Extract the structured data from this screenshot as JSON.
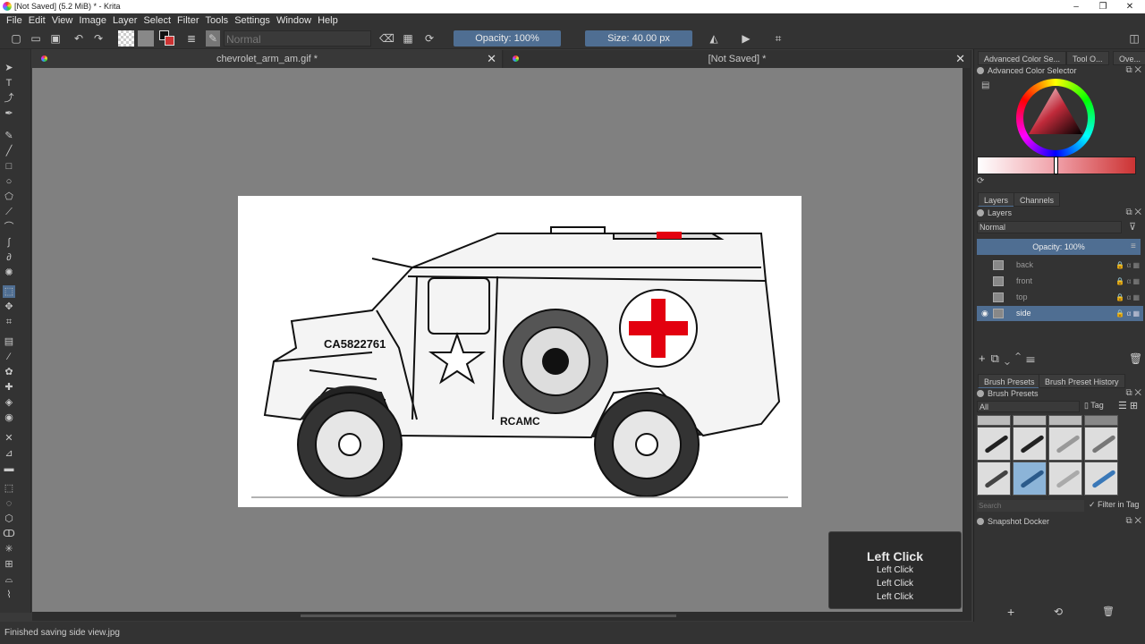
{
  "window": {
    "title": "[Not Saved]  (5.2 MiB)  * - Krita",
    "minimize": "–",
    "maximize": "❐",
    "close": "✕"
  },
  "menu": [
    "File",
    "Edit",
    "View",
    "Image",
    "Layer",
    "Select",
    "Filter",
    "Tools",
    "Settings",
    "Window",
    "Help"
  ],
  "toolbar": {
    "blend_mode": "Normal",
    "opacity": "Opacity: 100%",
    "size": "Size: 40.00 px"
  },
  "tabs": [
    {
      "label": "chevrolet_arm_am.gif *",
      "close": "✕"
    },
    {
      "label": "[Not Saved]  *",
      "close": "✕"
    }
  ],
  "canvas": {
    "license_plate": "CA5822761",
    "unit_label": "RCAMC"
  },
  "overlay": {
    "title": "Left Click",
    "lines": [
      "Left Click",
      "Left Click",
      "Left Click"
    ]
  },
  "status": "Finished saving side view.jpg",
  "right_panel": {
    "top_tabs": [
      "Advanced Color Se...",
      "Tool O...",
      "Ove..."
    ],
    "color_selector_title": "Advanced Color Selector",
    "layers_tabs": [
      "Layers",
      "Channels"
    ],
    "layers_title": "Layers",
    "blend_mode": "Normal",
    "opacity": "Opacity:  100%",
    "layers": [
      {
        "name": "back",
        "selected": false
      },
      {
        "name": "front",
        "selected": false
      },
      {
        "name": "top",
        "selected": false
      },
      {
        "name": "side",
        "selected": true
      }
    ],
    "brush_tabs": [
      "Brush Presets",
      "Brush Preset History"
    ],
    "brush_title": "Brush Presets",
    "brush_filter": "All",
    "brush_tag": "Tag",
    "search_placeholder": "Search",
    "filter_in_tag": "Filter in Tag",
    "snapshot_title": "Snapshot Docker"
  },
  "colors": {
    "accent": "#4f6e92",
    "bg": "#333333",
    "canvas": "#808080",
    "cross": "#e3000f"
  }
}
